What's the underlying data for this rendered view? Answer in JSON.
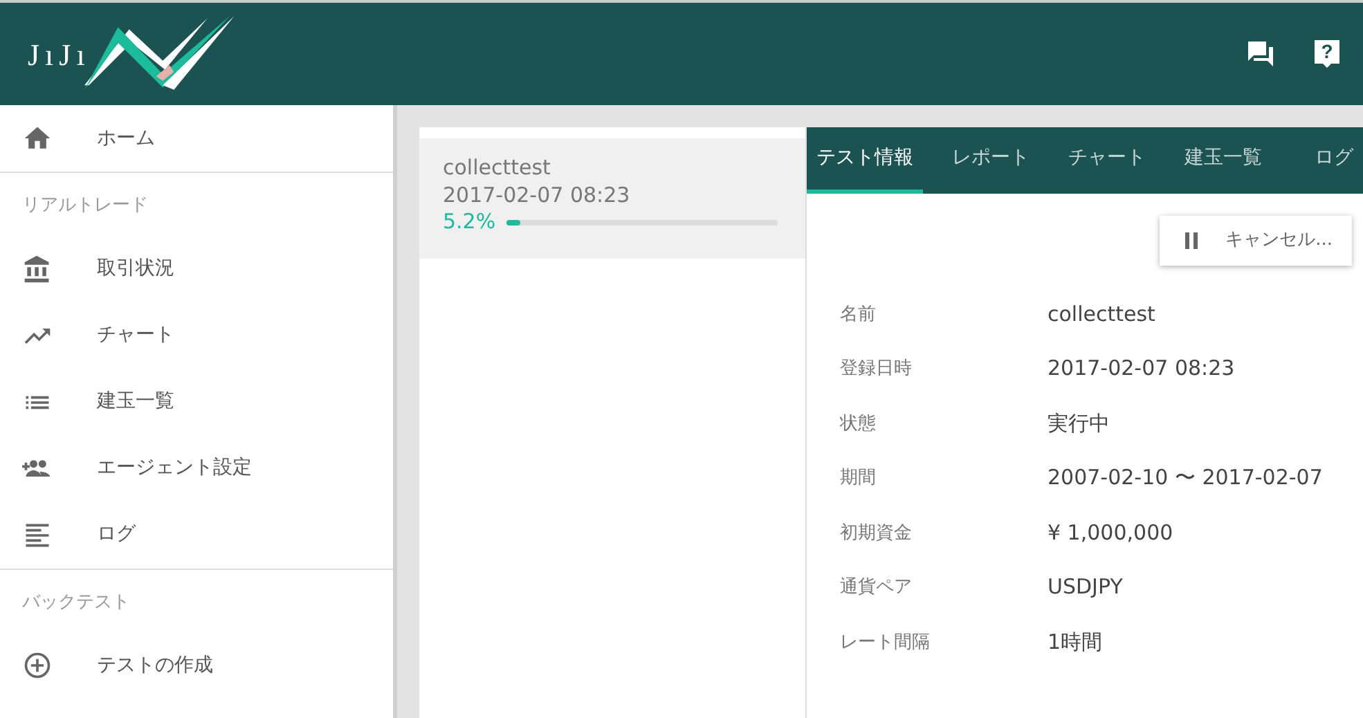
{
  "header": {
    "logo_text": "JıJı",
    "help_icon_glyph": "?"
  },
  "sidebar": {
    "sections": [
      {
        "items": [
          {
            "label": "ホーム"
          }
        ]
      },
      {
        "heading": "リアルトレード",
        "items": [
          {
            "label": "取引状況"
          },
          {
            "label": "チャート"
          },
          {
            "label": "建玉一覧"
          },
          {
            "label": "エージェント設定"
          },
          {
            "label": "ログ"
          }
        ]
      },
      {
        "heading": "バックテスト",
        "items": [
          {
            "label": "テストの作成"
          }
        ]
      }
    ]
  },
  "tests": [
    {
      "name": "collecttest",
      "date": "2017-02-07 08:23",
      "percent": "5.2%",
      "level": 0.052,
      "selected": true
    }
  ],
  "tabs": [
    {
      "label": "テスト情報",
      "selected": true
    },
    {
      "label": "レポート",
      "selected": false
    },
    {
      "label": "チャート",
      "selected": false
    },
    {
      "label": "建玉一覧",
      "selected": false
    },
    {
      "label": "ログ",
      "selected": false
    }
  ],
  "cancel_button": "キャンセル...",
  "details": [
    {
      "label": "名前",
      "value": "collecttest"
    },
    {
      "label": "登録日時",
      "value": "2017-02-07 08:23"
    },
    {
      "label": "状態",
      "value": "実行中"
    },
    {
      "label": "期間",
      "value": "2007-02-10 〜 2017-02-07"
    },
    {
      "label": "初期資金",
      "value": "¥ 1,000,000"
    },
    {
      "label": "通貨ペア",
      "value": "USDJPY"
    },
    {
      "label": "レート間隔",
      "value": "1時間"
    }
  ]
}
